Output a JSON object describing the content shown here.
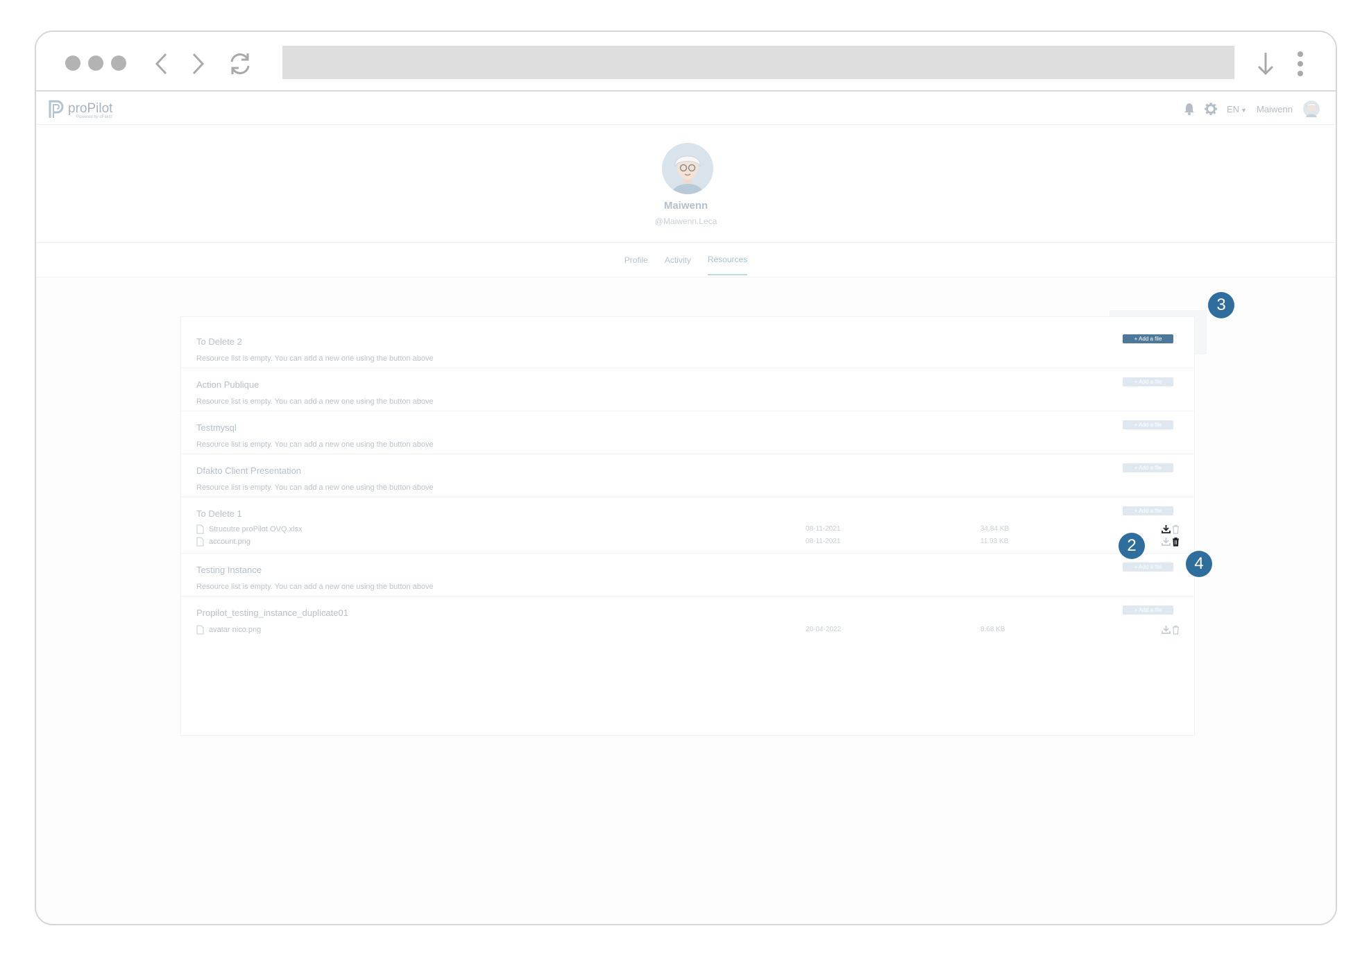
{
  "app": {
    "logo_text": "proPilot",
    "logo_sub": "Powered by dFakto"
  },
  "topnav": {
    "lang": "EN",
    "user": "Maiwenn",
    "icons": [
      "bell-icon",
      "gear-icon",
      "avatar"
    ]
  },
  "profile": {
    "name": "Maiwenn",
    "handle": "@Maiwenn.Leca"
  },
  "tabs": [
    "Profile",
    "Activity",
    "Resources"
  ],
  "active_tab": "Resources",
  "add_label": "+ Add a file",
  "empty_text": "Resource list is empty. You can add a new one using the button above",
  "sections": [
    {
      "title": "To Delete 2",
      "files": []
    },
    {
      "title": "Action Publique",
      "files": []
    },
    {
      "title": "Testmysql",
      "files": []
    },
    {
      "title": "Dfakto Client Presentation",
      "files": []
    },
    {
      "title": "To Delete 1",
      "files": [
        {
          "name": "Strucutre proPilot OVQ.xlsx",
          "date": "08-11-2021",
          "size": "34.84 KB"
        },
        {
          "name": "account.png",
          "date": "08-11-2021",
          "size": "11.93 KB"
        }
      ]
    },
    {
      "title": "Testing Instance",
      "files": []
    },
    {
      "title": "Propilot_testing_instance_duplicate01",
      "files": [
        {
          "name": "avatar nico.png",
          "date": "20-04-2022",
          "size": "8.68 KB"
        }
      ]
    }
  ],
  "callouts": [
    "2",
    "3",
    "4"
  ],
  "colors": {
    "accent": "#4d7899",
    "callout": "#2f6d9c"
  }
}
